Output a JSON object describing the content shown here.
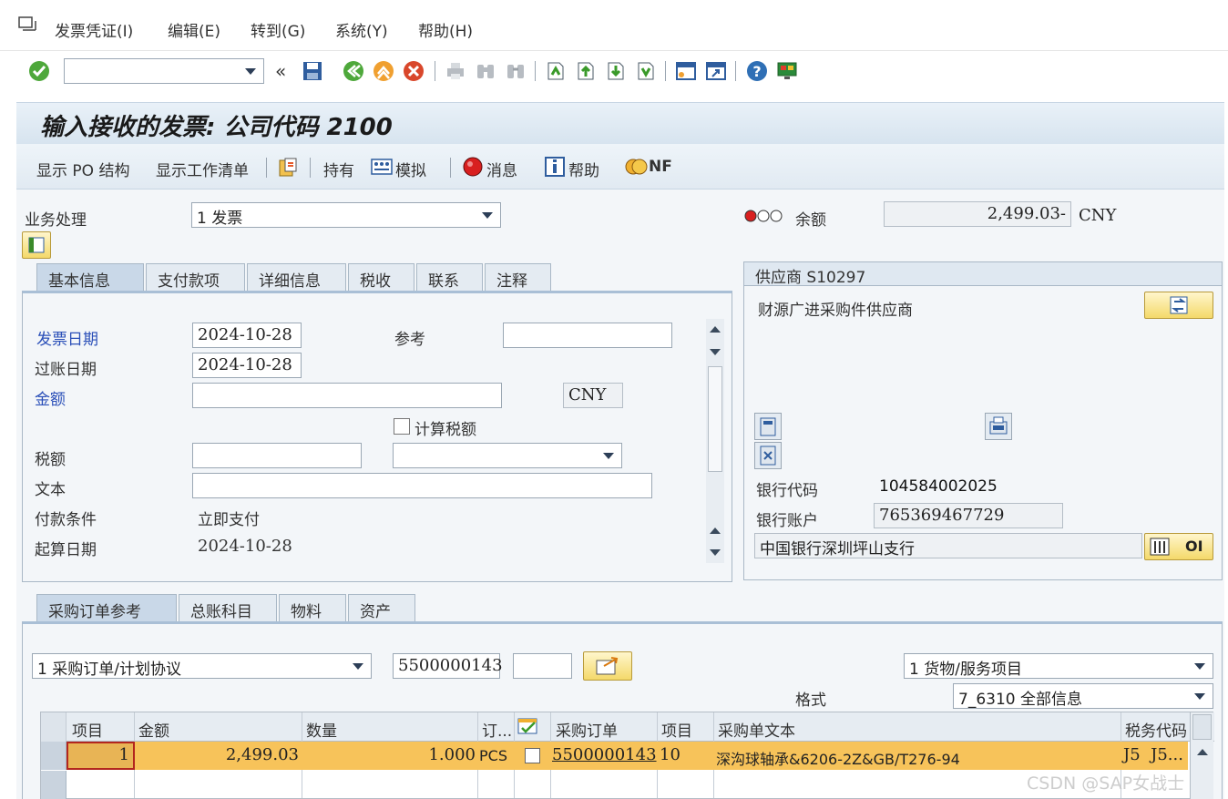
{
  "menu": {
    "items": [
      "发票凭证(I)",
      "编辑(E)",
      "转到(G)",
      "系统(Y)",
      "帮助(H)"
    ]
  },
  "window": {
    "title": "输入接收的发票: 公司代码 2100"
  },
  "apptoolbar": {
    "show_po_structure": "显示 PO 结构",
    "show_worklist": "显示工作清单",
    "hold": "持有",
    "simulate": "模拟",
    "messages": "消息",
    "help": "帮助",
    "nf": "NF"
  },
  "header": {
    "transaction_label": "业务处理",
    "transaction_value": "1 发票",
    "balance_label": "余额",
    "balance_value": "2,499.03-",
    "balance_currency": "CNY"
  },
  "tabs_top": [
    "基本信息",
    "支付款项",
    "详细信息",
    "税收",
    "联系",
    "注释"
  ],
  "basic": {
    "invoice_date_label": "发票日期",
    "invoice_date_value": "2024-10-28",
    "reference_label": "参考",
    "reference_value": "",
    "posting_date_label": "过账日期",
    "posting_date_value": "2024-10-28",
    "amount_label": "金额",
    "amount_value": "",
    "currency": "CNY",
    "calc_tax_label": "计算税额",
    "tax_label": "税额",
    "tax_value": "",
    "tax_code_value": "",
    "text_label": "文本",
    "text_value": "",
    "payment_terms_label": "付款条件",
    "payment_terms_value": "立即支付",
    "baseline_date_label": "起算日期",
    "baseline_date_value": "2024-10-28"
  },
  "vendor": {
    "header": "供应商 S10297",
    "name": "财源广进采购件供应商",
    "bank_key_label": "银行代码",
    "bank_key_value": "104584002025",
    "bank_account_label": "银行账户",
    "bank_account_value": "765369467729",
    "bank_name": "中国银行深圳坪山支行",
    "oi_label": "OI"
  },
  "tabs_bottom": [
    "采购订单参考",
    "总账科目",
    "物料",
    "资产"
  ],
  "po_ref": {
    "doc_type": "1 采购订单/计划协议",
    "po_number": "5500000143",
    "po_item": "",
    "item_type": "1 货物/服务项目",
    "layout_label": "格式",
    "layout_value": "7_6310 全部信息"
  },
  "grid": {
    "columns": [
      "项目",
      "金额",
      "数量",
      "订...",
      "",
      "采购订单",
      "项目",
      "采购单文本",
      "税务代码"
    ],
    "rows": [
      {
        "item": "1",
        "amount": "2,499.03",
        "quantity": "1.000",
        "unit": "PCS",
        "po": "5500000143",
        "po_item": "10",
        "text": "深沟球轴承&6206-2Z&GB/T276-94",
        "tax": "J5  J5..."
      }
    ]
  },
  "watermark": "CSDN @SAP女战士"
}
